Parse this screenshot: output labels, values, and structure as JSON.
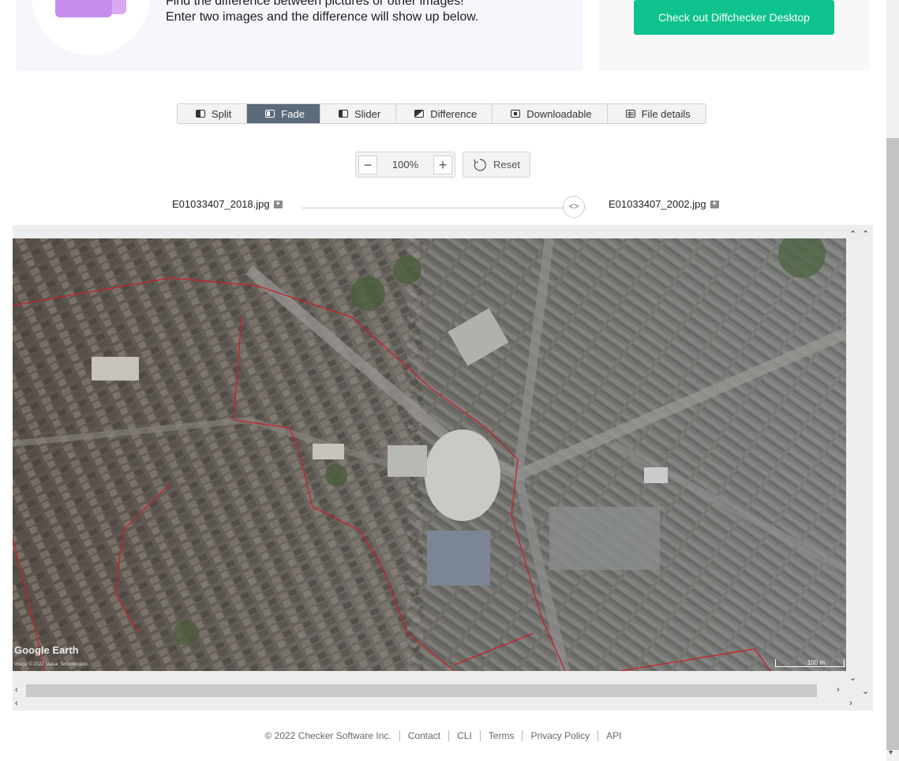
{
  "banner": {
    "line1": "Find the difference between pictures or other images!",
    "line2": "Enter two images and the difference will show up below.",
    "desktop_button": "Check out Diffchecker Desktop"
  },
  "tabs": [
    {
      "label": "Split",
      "icon": "split-icon",
      "active": false
    },
    {
      "label": "Fade",
      "icon": "fade-icon",
      "active": true
    },
    {
      "label": "Slider",
      "icon": "slider-icon",
      "active": false
    },
    {
      "label": "Difference",
      "icon": "difference-icon",
      "active": false
    },
    {
      "label": "Downloadable",
      "icon": "download-icon",
      "active": false
    },
    {
      "label": "File details",
      "icon": "file-details-icon",
      "active": false
    }
  ],
  "zoom": {
    "value": "100%",
    "minus": "−",
    "plus": "+",
    "reset_label": "Reset"
  },
  "files": {
    "left": "E01033407_2018.jpg",
    "right": "E01033407_2002.jpg"
  },
  "fade_handle": "<>",
  "map": {
    "logo": "Google Earth",
    "credit": "Image © 2022 Maxar Technologies",
    "scale": "100 m"
  },
  "footer": {
    "copyright": "© 2022 Checker Software Inc.",
    "links": [
      "Contact",
      "CLI",
      "Terms",
      "Privacy Policy",
      "API"
    ]
  },
  "colors": {
    "accent_green": "#0ec38d",
    "active_tab": "#5c6b7a",
    "boundary_red": "#c8202a"
  }
}
